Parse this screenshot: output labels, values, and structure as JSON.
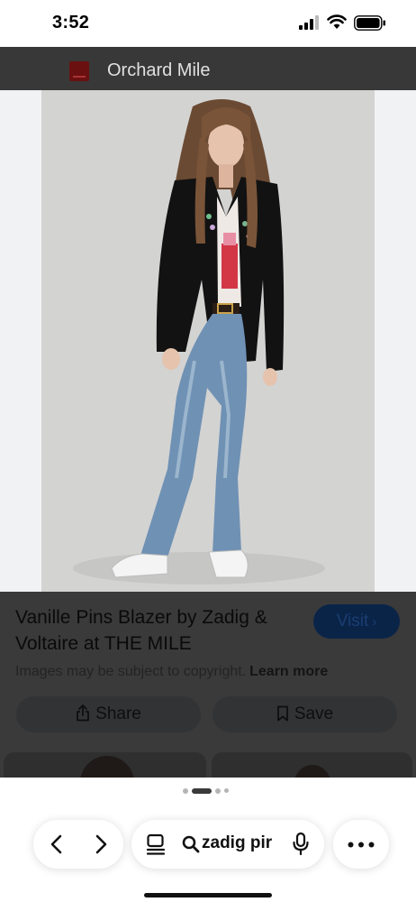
{
  "status_bar": {
    "time": "3:52"
  },
  "site": {
    "name": "Orchard Mile",
    "logo_color": "#6a1010"
  },
  "product": {
    "title": "Vanille Pins Blazer by Zadig & Voltaire at THE MILE",
    "image_description_icon": "photo"
  },
  "actions": {
    "visit_label": "Visit",
    "visit_color": "#0a2448",
    "copyright_text": "Images may be subject to copyright.",
    "learn_more_label": "Learn more",
    "share_label": "Share",
    "save_label": "Save"
  },
  "browser_bar": {
    "search_text": "zadig pir",
    "icons": [
      "back-icon",
      "forward-icon",
      "page-icon",
      "search-icon",
      "mic-icon",
      "more-icon"
    ]
  },
  "pager": {
    "count": 4,
    "active_index": 1
  }
}
